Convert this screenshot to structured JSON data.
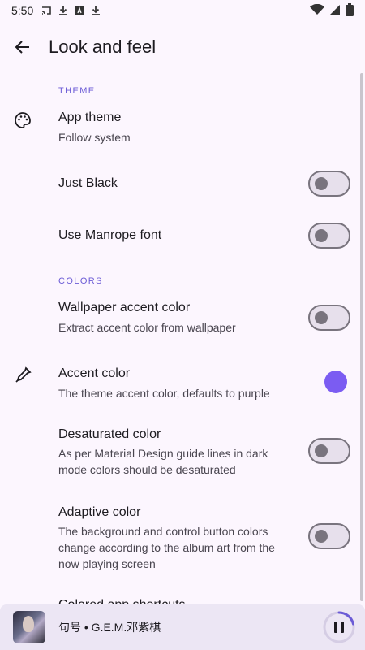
{
  "status_bar": {
    "time": "5:50"
  },
  "header": {
    "title": "Look and feel"
  },
  "sections": {
    "theme": "THEME",
    "colors": "COLORS"
  },
  "settings": {
    "app_theme": {
      "title": "App theme",
      "subtitle": "Follow system"
    },
    "just_black": {
      "title": "Just Black",
      "enabled": false
    },
    "manrope": {
      "title": "Use Manrope font",
      "enabled": false
    },
    "wallpaper_accent": {
      "title": "Wallpaper accent color",
      "subtitle": "Extract accent color from wallpaper",
      "enabled": false
    },
    "accent_color": {
      "title": "Accent color",
      "subtitle": "The theme accent color, defaults to purple",
      "color": "#7b5cf2"
    },
    "desaturated": {
      "title": "Desaturated color",
      "subtitle": "As per Material Design guide lines in dark mode colors should be desaturated",
      "enabled": false
    },
    "adaptive": {
      "title": "Adaptive color",
      "subtitle": "The background and control button colors change according to the album art from the now playing screen",
      "enabled": false
    },
    "colored_shortcuts": {
      "title": "Colored app shortcuts"
    }
  },
  "mini_player": {
    "song": "句号 • G.E.M.邓紫棋",
    "state": "playing"
  }
}
